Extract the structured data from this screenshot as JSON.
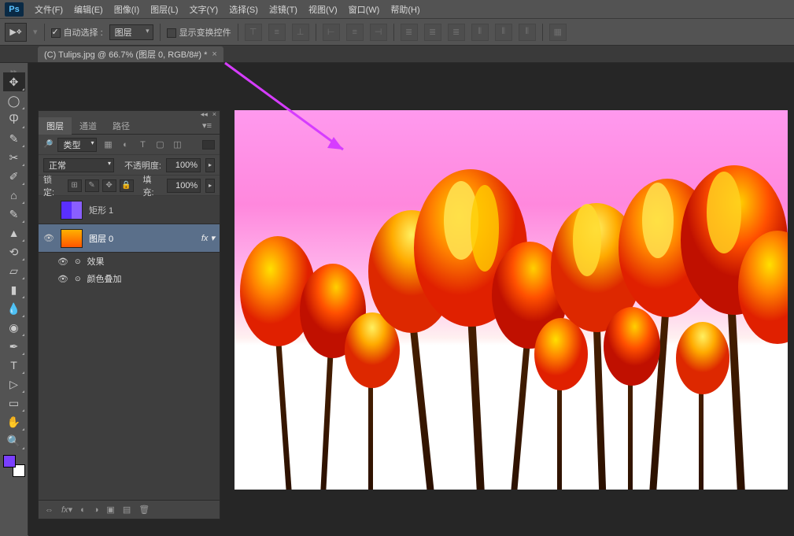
{
  "app": {
    "logo": "Ps"
  },
  "menu": {
    "file": "文件(F)",
    "edit": "编辑(E)",
    "image": "图像(I)",
    "layer": "图层(L)",
    "type": "文字(Y)",
    "select": "选择(S)",
    "filter": "滤镜(T)",
    "view": "视图(V)",
    "window": "窗口(W)",
    "help": "帮助(H)"
  },
  "options": {
    "auto_select_label": "自动选择 :",
    "auto_select_target": "图层",
    "show_transform_label": "显示变换控件"
  },
  "document": {
    "tab_title": "(C) Tulips.jpg @ 66.7% (图层 0, RGB/8#) *"
  },
  "panel": {
    "tab_layers": "图层",
    "tab_channels": "通道",
    "tab_paths": "路径",
    "filter_kind": "类型",
    "blend_mode": "正常",
    "opacity_label": "不透明度:",
    "opacity_value": "100%",
    "lock_label": "锁定:",
    "fill_label": "填充:",
    "fill_value": "100%",
    "layers": [
      {
        "name": "矩形 1",
        "visible": false,
        "thumb": "rect"
      },
      {
        "name": "图层 0",
        "visible": true,
        "thumb": "img",
        "fx": true
      }
    ],
    "fx_label": "效果",
    "fx_item": "颜色叠加"
  }
}
